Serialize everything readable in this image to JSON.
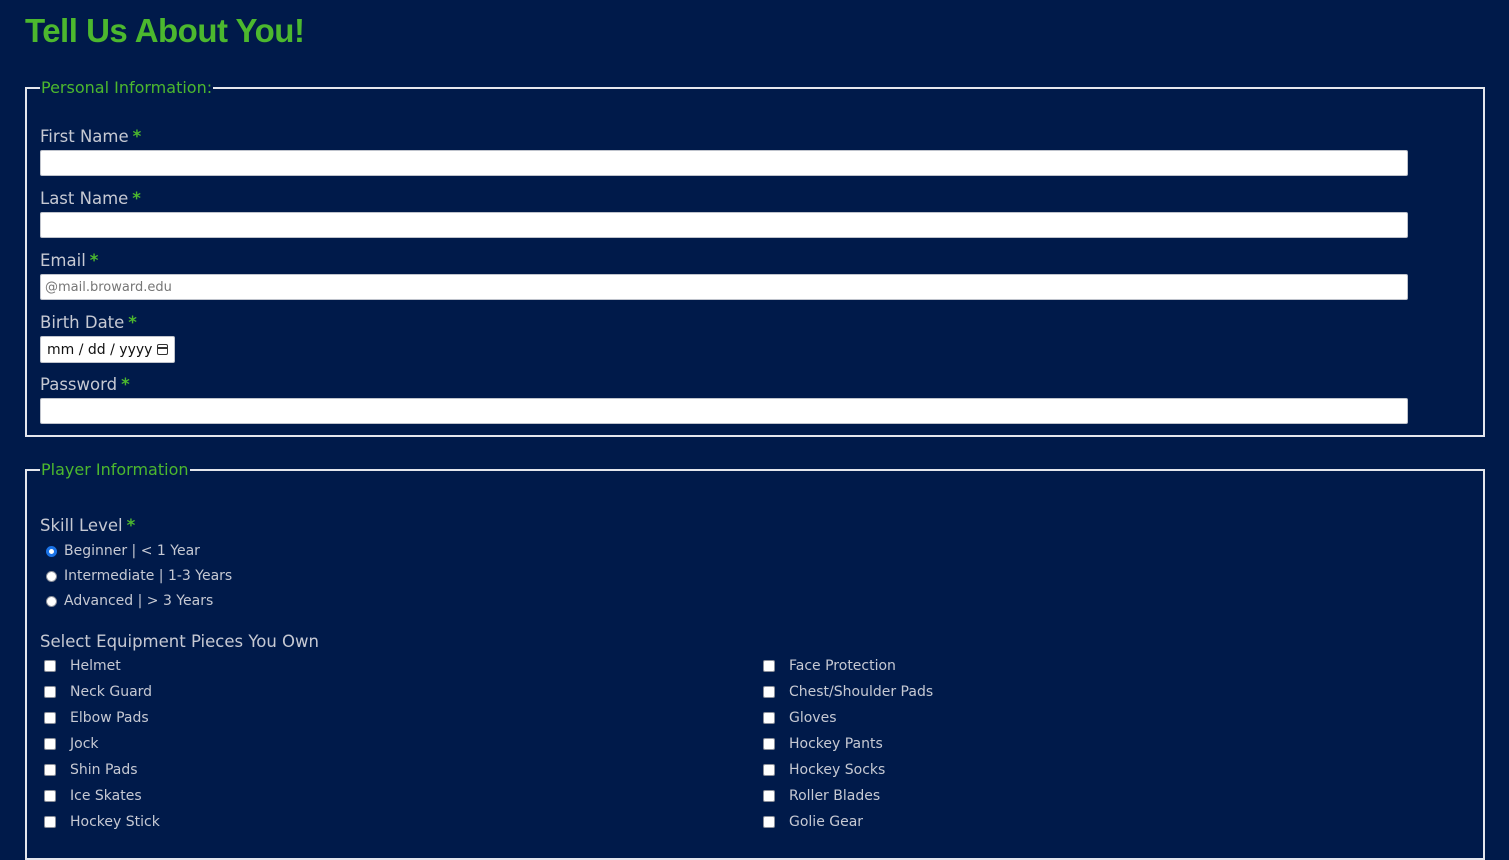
{
  "page": {
    "title": "Tell Us About You!"
  },
  "personal": {
    "legend": "Personal Information:",
    "first_name": {
      "label": "First Name",
      "value": ""
    },
    "last_name": {
      "label": "Last Name",
      "value": ""
    },
    "email": {
      "label": "Email",
      "value": "",
      "placeholder": "@mail.broward.edu"
    },
    "birth_date": {
      "label": "Birth Date",
      "placeholder": "mm / dd / yyyy"
    },
    "password": {
      "label": "Password",
      "value": ""
    },
    "required_marker": "*"
  },
  "player": {
    "legend": "Player Information",
    "skill": {
      "label": "Skill Level",
      "options": [
        {
          "label": "Beginner | < 1 Year",
          "selected": true
        },
        {
          "label": "Intermediate | 1-3 Years",
          "selected": false
        },
        {
          "label": "Advanced | > 3 Years",
          "selected": false
        }
      ]
    },
    "equipment": {
      "label": "Select Equipment Pieces You Own",
      "left": [
        "Helmet",
        "Neck Guard",
        "Elbow Pads",
        "Jock",
        "Shin Pads",
        "Ice Skates",
        "Hockey Stick"
      ],
      "right": [
        "Face Protection",
        "Chest/Shoulder Pads",
        "Gloves",
        "Hockey Pants",
        "Hockey Socks",
        "Roller Blades",
        "Golie Gear"
      ]
    }
  },
  "colors": {
    "background": "#001a4a",
    "accent": "#4cb82e",
    "radio_selected": "#1a73e8"
  }
}
